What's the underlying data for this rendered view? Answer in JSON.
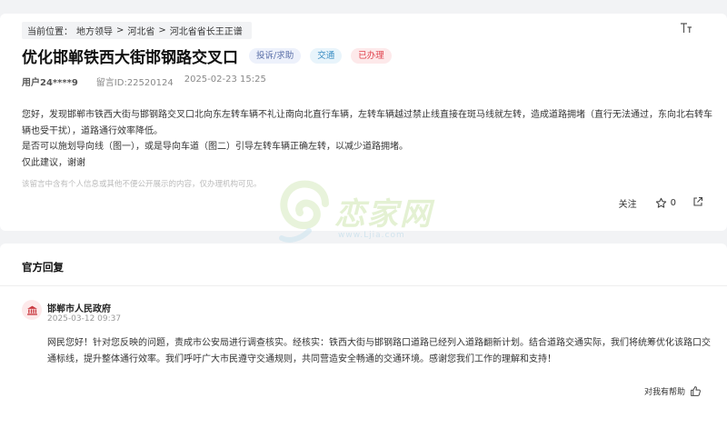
{
  "breadcrumb": {
    "prefix": "当前位置：",
    "items": [
      "地方领导",
      ">",
      "河北省",
      ">",
      "河北省省长王正谱"
    ]
  },
  "post": {
    "title": "优化邯郸铁西大街邯钢路交叉口",
    "tags": {
      "type": "投诉/求助",
      "category": "交通",
      "status": "已办理"
    },
    "user": "用户24****9",
    "message_id": "留言ID:22520124",
    "datetime": "2025-02-23 15:25",
    "paragraphs": [
      "您好，发现邯郸市铁西大街与邯钢路交叉口北向东左转车辆不礼让南向北直行车辆，左转车辆越过禁止线直接在斑马线就左转，造成道路拥堵（直行无法通过，东向北右转车辆也受干扰），道路通行效率降低。",
      "是否可以施划导向线（图一），或是导向车道（图二）引导左转车辆正确左转，以减少道路拥堵。",
      "仅此建议，谢谢"
    ],
    "privacy_note": "该留言中含有个人信息或其他不便公开展示的内容，仅办理机构可见。",
    "follow_label": "关注",
    "star_count": "0"
  },
  "watermark": {
    "text": "恋家网",
    "url": "www.Ljia.com"
  },
  "reply_section": {
    "title": "官方回复",
    "org_name": "邯郸市人民政府",
    "datetime": "2025-03-12 09:37",
    "content": "网民您好！针对您反映的问题，责成市公安局进行调查核实。经核实：铁西大街与邯钢路口道路已经列入道路翻新计划。结合道路交通实际，我们将统筹优化该路口交通标线，提升整体通行效率。我们呼吁广大市民遵守交通规则，共同营造安全畅通的交通环境。感谢您我们工作的理解和支持！",
    "helpful_label": "对我有帮助"
  },
  "colors": {
    "status_red": "#e0434e",
    "category_blue": "#3d8fc4",
    "type_blue": "#5a6fa8",
    "gov_red": "#c9383f"
  },
  "icons": [
    "font-size-icon",
    "star-icon",
    "share-icon",
    "government-building-icon",
    "thumbs-up-icon"
  ]
}
